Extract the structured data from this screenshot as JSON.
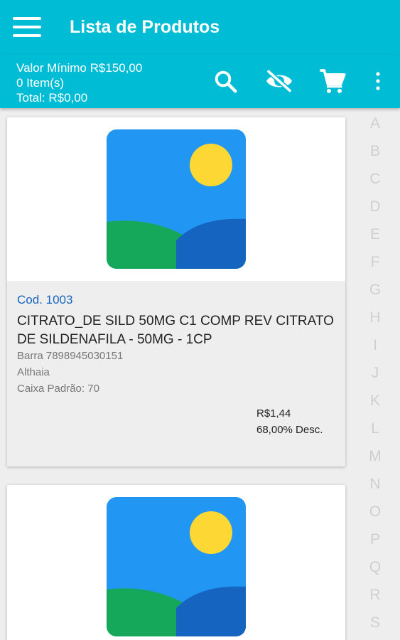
{
  "header": {
    "title": "Lista de Produtos"
  },
  "summary": {
    "min_value": "Valor Mínimo R$150,00",
    "items": "0 Item(s)",
    "total": "Total: R$0,00"
  },
  "toolbar": {
    "icons": [
      "search-icon",
      "eye-off-icon",
      "cart-icon",
      "more-vert-icon"
    ]
  },
  "alphabet_index": [
    "A",
    "B",
    "C",
    "D",
    "E",
    "F",
    "G",
    "H",
    "I",
    "J",
    "K",
    "L",
    "M",
    "N",
    "O",
    "P",
    "Q",
    "R",
    "S"
  ],
  "products": [
    {
      "code": "Cod. 1003",
      "name": "CITRATO_DE SILD 50MG C1 COMP REV CITRATO DE SILDENAFILA - 50MG - 1CP",
      "barcode": "Barra 7898945030151",
      "brand": "Althaia",
      "pack": "Caixa Padrão: 70",
      "price": "R$1,44",
      "discount": "68,00% Desc."
    }
  ],
  "colors": {
    "primary": "#00bcd4",
    "code_text": "#1565c0",
    "index_text": "#cfcfcf",
    "placeholder_sky": "#2196f3",
    "placeholder_sun": "#fdd835",
    "placeholder_hill_light": "#16a85a",
    "placeholder_hill_dark": "#1565c0"
  }
}
